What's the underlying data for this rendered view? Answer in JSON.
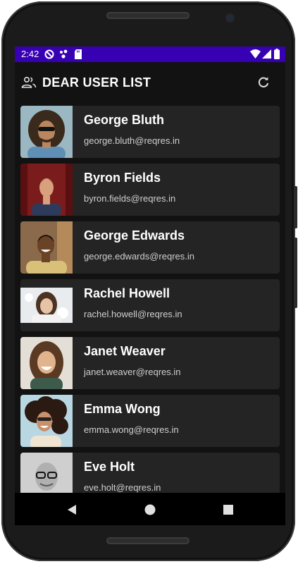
{
  "status_bar": {
    "time": "2:42",
    "icons": [
      "do-not-disturb-icon",
      "assistant-icon",
      "sd-card-icon",
      "wifi-icon",
      "signal-icon",
      "battery-icon"
    ]
  },
  "app_bar": {
    "title": "DEAR USER LIST",
    "leading_icon": "people-icon",
    "action_icon": "refresh-icon"
  },
  "users": [
    {
      "name": "George Bluth",
      "email": "george.bluth@reqres.in",
      "bg": "#9ab7c2",
      "skin": "#b98660",
      "hair": "#3a2a1c",
      "shirt": "#5f8fb5"
    },
    {
      "name": "Byron Fields",
      "email": "byron.fields@reqres.in",
      "bg": "#7a1c1c",
      "skin": "#d8a07c",
      "hair": "#8a5a2a",
      "shirt": "#2e3a5a"
    },
    {
      "name": "George Edwards",
      "email": "george.edwards@reqres.in",
      "bg": "#8a6a4a",
      "skin": "#6a4226",
      "hair": "#1e140c",
      "shirt": "#d9c079"
    },
    {
      "name": "Rachel Howell",
      "email": "rachel.howell@reqres.in",
      "bg": "#e8ecef",
      "skin": "#e6c3a6",
      "hair": "#4b3222",
      "shirt": "#f2f2f2"
    },
    {
      "name": "Janet Weaver",
      "email": "janet.weaver@reqres.in",
      "bg": "#e4dfd6",
      "skin": "#e1b48d",
      "hair": "#5a3a22",
      "shirt": "#3d5a4a"
    },
    {
      "name": "Emma Wong",
      "email": "emma.wong@reqres.in",
      "bg": "#b9d7e3",
      "skin": "#c8916b",
      "hair": "#2a1a12",
      "shirt": "#efe4d2"
    },
    {
      "name": "Eve Holt",
      "email": "eve.holt@reqres.in",
      "bg": "#cfcfcf",
      "skin": "#b0b0b0",
      "hair": "#5c5c5c",
      "shirt": "#2a2a2a"
    }
  ],
  "nav_bar": {
    "back_icon": "back-triangle-icon",
    "home_icon": "home-circle-icon",
    "recents_icon": "recents-square-icon"
  },
  "colors": {
    "status_bar": "#3700b3",
    "background": "#121212",
    "card": "#242424",
    "text_primary": "#ffffff",
    "text_secondary": "#cfcfcf"
  }
}
